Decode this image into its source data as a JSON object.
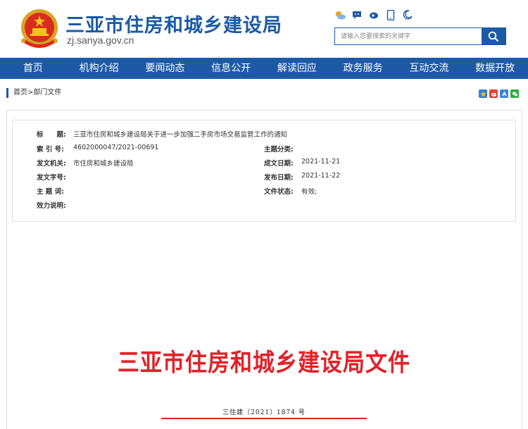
{
  "header": {
    "title": "三亚市住房和城乡建设局",
    "url": "zj.sanya.gov.cn",
    "emblem_icon": "national-emblem-icon",
    "tools": [
      {
        "name": "weather-icon",
        "color": "#e8583b"
      },
      {
        "name": "wechat-icon",
        "color": "#1c5aa6"
      },
      {
        "name": "weibo-icon",
        "color": "#1c5aa6"
      },
      {
        "name": "mobile-icon",
        "color": "#1c5aa6"
      },
      {
        "name": "night-mode-icon",
        "color": "#1c5aa6"
      }
    ]
  },
  "search": {
    "placeholder": "请输入您要搜索的关键字",
    "button_icon": "search-icon"
  },
  "nav": {
    "items": [
      "首页",
      "机构介绍",
      "要闻动态",
      "信息公开",
      "解读回应",
      "政务服务",
      "互动交流",
      "数据开放"
    ]
  },
  "breadcrumb": {
    "home": "首页",
    "separator": ">",
    "current": "部门文件"
  },
  "share": [
    {
      "name": "qzone-share-icon",
      "color": "#2e7fd6"
    },
    {
      "name": "weibo-share-icon",
      "color": "#e5412f"
    },
    {
      "name": "other-share-icon",
      "color": "#3b82d6"
    },
    {
      "name": "wechat-share-icon",
      "color": "#2aae3a"
    }
  ],
  "meta": {
    "title_label": "标　　题:",
    "title_value": "三亚市住房和城乡建设局关于进一步加强二手房市场交易监管工作的通知",
    "index_label": "索 引 号:",
    "index_value": "4602000047/2021-00691",
    "topic_label": "主题分类:",
    "topic_value": "",
    "issuer_label": "发文机关:",
    "issuer_value": "市住房和城乡建设局",
    "created_label": "成文日期:",
    "created_value": "2021-11-21",
    "docno_label": "发文字号:",
    "docno_value": "",
    "published_label": "发布日期:",
    "published_value": "2021-11-22",
    "keywords_label": "主 题 词:",
    "keywords_value": "",
    "status_label": "文件状态:",
    "status_value": "有效;",
    "effect_label": "效力说明:",
    "effect_value": ""
  },
  "document": {
    "header_title": "三亚市住房和城乡建设局文件",
    "number": "三住建〔2021〕1874 号",
    "accent_color": "#e0232a"
  },
  "colors": {
    "brand_blue": "#1c5aa6"
  }
}
